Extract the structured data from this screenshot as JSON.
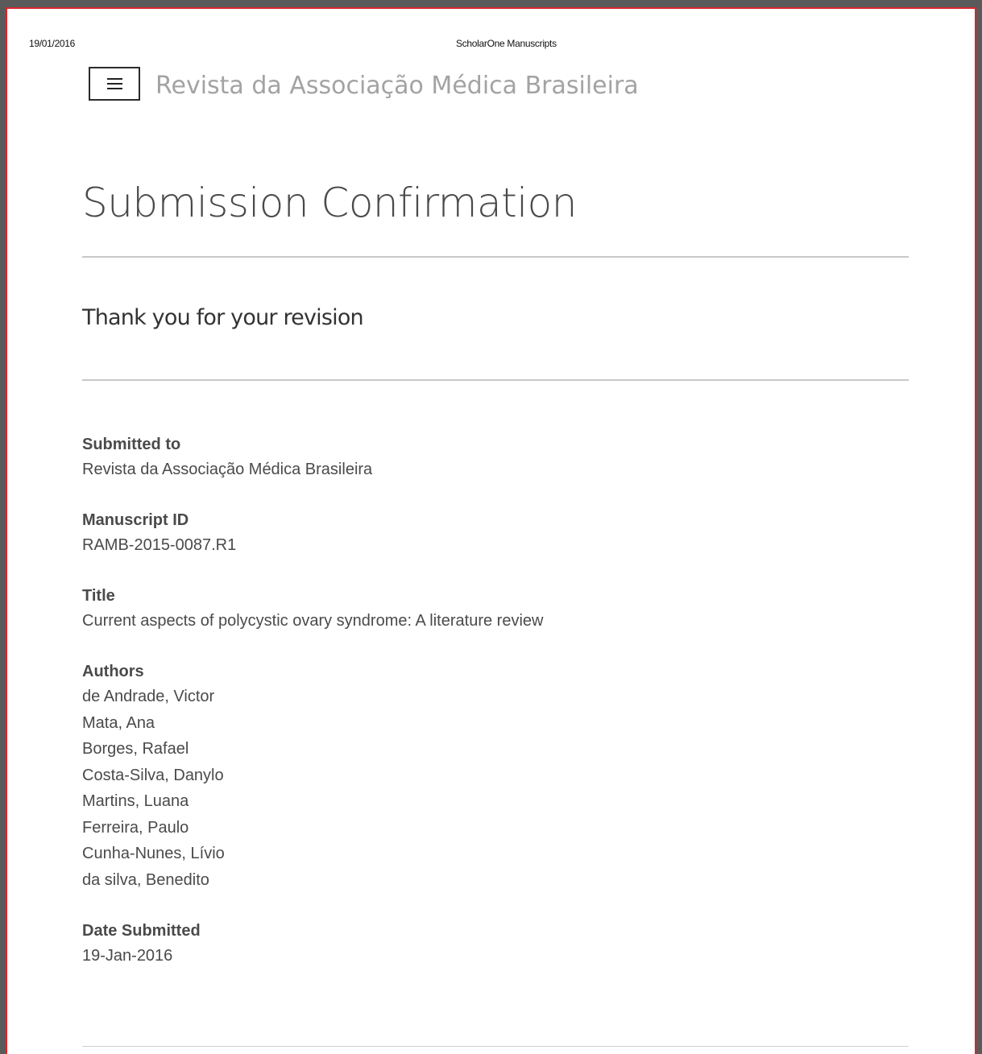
{
  "print_header": {
    "date": "19/01/2016",
    "title": "ScholarOne Manuscripts"
  },
  "header": {
    "menu_icon": "hamburger-menu-icon",
    "journal_name": "Revista da Associação Médica Brasileira"
  },
  "main": {
    "title": "Submission Confirmation",
    "subtitle": "Thank you for your revision"
  },
  "details": {
    "submitted_to": {
      "label": "Submitted to",
      "value": "Revista da Associação Médica Brasileira"
    },
    "manuscript_id": {
      "label": "Manuscript ID",
      "value": "RAMB-2015-0087.R1"
    },
    "title": {
      "label": "Title",
      "value": "Current aspects of polycystic ovary syndrome: A literature review"
    },
    "authors": {
      "label": "Authors",
      "values": [
        "de Andrade, Victor",
        "Mata, Ana",
        "Borges, Rafael",
        "Costa-Silva, Danylo",
        "Martins, Luana",
        "Ferreira, Paulo",
        "Cunha-Nunes, Lívio",
        "da silva, Benedito"
      ]
    },
    "date_submitted": {
      "label": "Date Submitted",
      "value": "19-Jan-2016"
    }
  },
  "colors": {
    "frame_border": "#d9262b",
    "background": "#5a5a5a",
    "title_text": "#4a4a4a",
    "journal_text": "#a3a3a3",
    "rule": "#c8c8c8"
  }
}
